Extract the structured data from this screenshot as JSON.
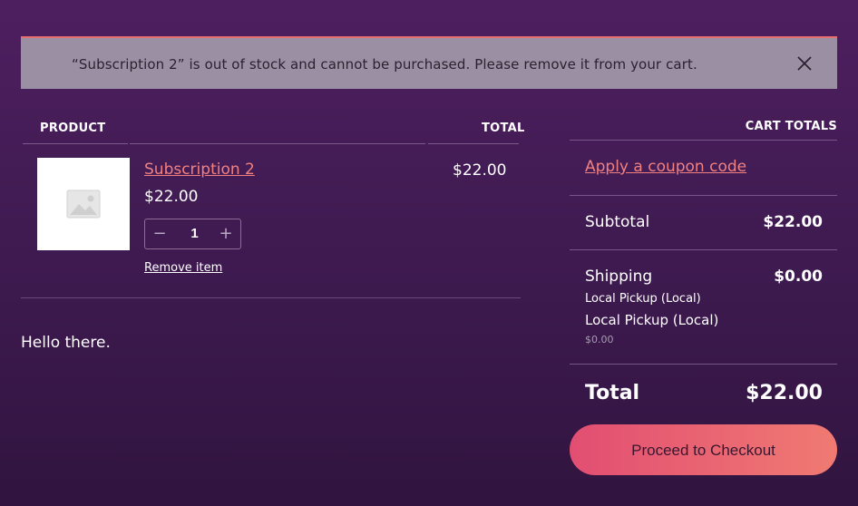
{
  "notice": {
    "message": "“Subscription 2” is out of stock and cannot be purchased. Please remove it from your cart.",
    "close_icon": "close-icon"
  },
  "cart_table": {
    "headers": {
      "product": "PRODUCT",
      "total": "TOTAL"
    },
    "items": [
      {
        "thumbnail_icon": "image-placeholder-icon",
        "name": "Subscription 2",
        "price": "$22.00",
        "quantity": "1",
        "remove_label": "Remove item",
        "line_total": "$22.00"
      }
    ]
  },
  "content": {
    "message": "Hello there."
  },
  "cart_totals": {
    "heading": "CART TOTALS",
    "coupon_link": "Apply a coupon code",
    "subtotal_label": "Subtotal",
    "subtotal_value": "$22.00",
    "shipping_label": "Shipping",
    "shipping_value": "$0.00",
    "shipping_method": "Local Pickup (Local)",
    "shipping_option_label": "Local Pickup (Local)",
    "shipping_option_price": "$0.00",
    "total_label": "Total",
    "total_value": "$22.00",
    "checkout_label": "Proceed to Checkout"
  },
  "colors": {
    "background_top": "#4e1f5f",
    "background_bottom": "#31143f",
    "accent": "#f08181",
    "notice_bg": "#9b8fa4",
    "notice_border": "#e86f6f",
    "button_gradient_start": "#e24e72",
    "button_gradient_end": "#f07a72"
  }
}
